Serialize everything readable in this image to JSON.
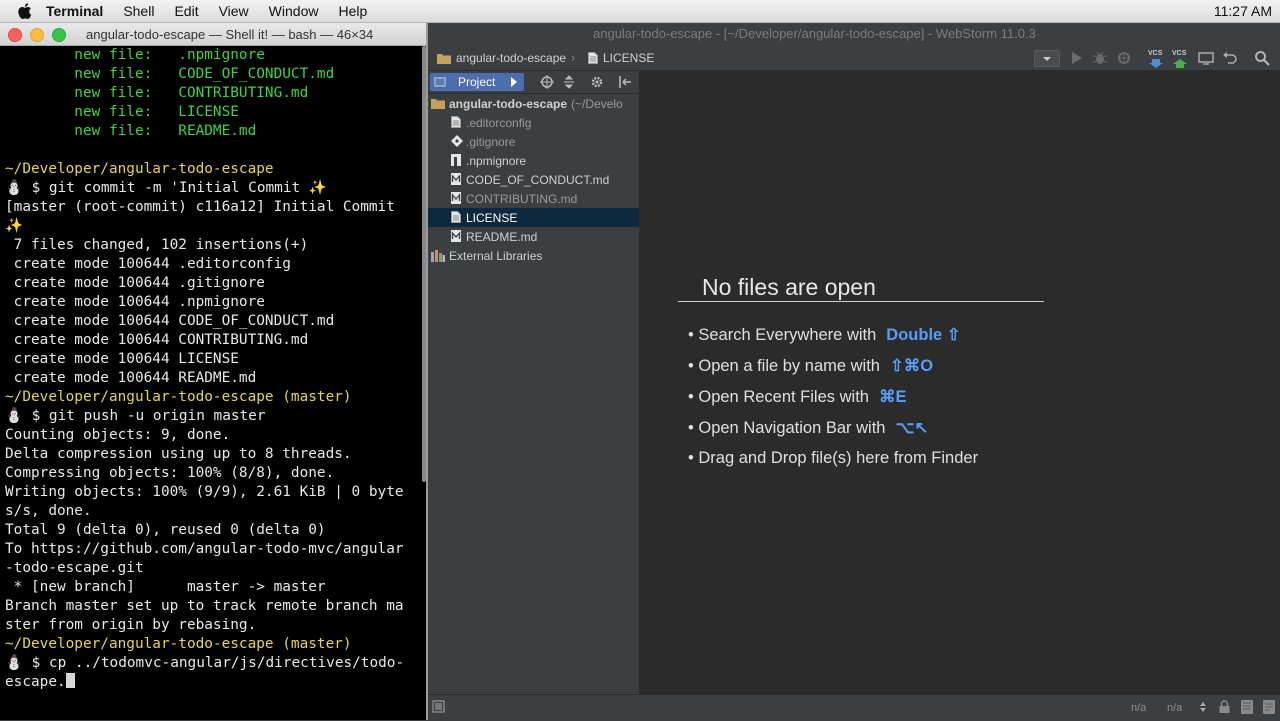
{
  "menubar": {
    "items": [
      "Terminal",
      "Shell",
      "Edit",
      "View",
      "Window",
      "Help"
    ],
    "clock": "11:27 AM"
  },
  "terminal": {
    "title": "angular-todo-escape — Shell it! — bash — 46×34",
    "lines": [
      {
        "parts": [
          {
            "t": "        new file:   .npmignore",
            "c": "g"
          }
        ]
      },
      {
        "parts": [
          {
            "t": "        new file:   CODE_OF_CONDUCT.md",
            "c": "g"
          }
        ]
      },
      {
        "parts": [
          {
            "t": "        new file:   CONTRIBUTING.md",
            "c": "g"
          }
        ]
      },
      {
        "parts": [
          {
            "t": "        new file:   LICENSE",
            "c": "g"
          }
        ]
      },
      {
        "parts": [
          {
            "t": "        new file:   README.md",
            "c": "g"
          }
        ]
      },
      {
        "parts": [
          {
            "t": "",
            "c": ""
          }
        ]
      },
      {
        "parts": [
          {
            "t": "~/Developer/angular-todo-escape",
            "c": "y"
          }
        ]
      },
      {
        "parts": [
          {
            "t": "⛄ $ git commit -m 'Initial Commit ✨",
            "c": ""
          }
        ]
      },
      {
        "parts": [
          {
            "t": "[master (root-commit) c116a12] Initial Commit",
            "c": ""
          }
        ]
      },
      {
        "parts": [
          {
            "t": "✨",
            "c": "y"
          }
        ]
      },
      {
        "parts": [
          {
            "t": " 7 files changed, 102 insertions(+)",
            "c": ""
          }
        ]
      },
      {
        "parts": [
          {
            "t": " create mode 100644 .editorconfig",
            "c": ""
          }
        ]
      },
      {
        "parts": [
          {
            "t": " create mode 100644 .gitignore",
            "c": ""
          }
        ]
      },
      {
        "parts": [
          {
            "t": " create mode 100644 .npmignore",
            "c": ""
          }
        ]
      },
      {
        "parts": [
          {
            "t": " create mode 100644 CODE_OF_CONDUCT.md",
            "c": ""
          }
        ]
      },
      {
        "parts": [
          {
            "t": " create mode 100644 CONTRIBUTING.md",
            "c": ""
          }
        ]
      },
      {
        "parts": [
          {
            "t": " create mode 100644 LICENSE",
            "c": ""
          }
        ]
      },
      {
        "parts": [
          {
            "t": " create mode 100644 README.md",
            "c": ""
          }
        ]
      },
      {
        "parts": [
          {
            "t": "~/Developer/angular-todo-escape (master)",
            "c": "y"
          }
        ]
      },
      {
        "parts": [
          {
            "t": "⛄ $ git push -u origin master",
            "c": ""
          }
        ]
      },
      {
        "parts": [
          {
            "t": "Counting objects: 9, done.",
            "c": ""
          }
        ]
      },
      {
        "parts": [
          {
            "t": "Delta compression using up to 8 threads.",
            "c": ""
          }
        ]
      },
      {
        "parts": [
          {
            "t": "Compressing objects: 100% (8/8), done.",
            "c": ""
          }
        ]
      },
      {
        "parts": [
          {
            "t": "Writing objects: 100% (9/9), 2.61 KiB | 0 byte",
            "c": ""
          }
        ]
      },
      {
        "parts": [
          {
            "t": "s/s, done.",
            "c": ""
          }
        ]
      },
      {
        "parts": [
          {
            "t": "Total 9 (delta 0), reused 0 (delta 0)",
            "c": ""
          }
        ]
      },
      {
        "parts": [
          {
            "t": "To https://github.com/angular-todo-mvc/angular",
            "c": ""
          }
        ]
      },
      {
        "parts": [
          {
            "t": "-todo-escape.git",
            "c": ""
          }
        ]
      },
      {
        "parts": [
          {
            "t": " * [new branch]      master -> master",
            "c": ""
          }
        ]
      },
      {
        "parts": [
          {
            "t": "Branch master set up to track remote branch ma",
            "c": ""
          }
        ]
      },
      {
        "parts": [
          {
            "t": "ster from origin by rebasing.",
            "c": ""
          }
        ]
      },
      {
        "parts": [
          {
            "t": "~/Developer/angular-todo-escape (master)",
            "c": "y"
          }
        ]
      },
      {
        "parts": [
          {
            "t": "⛄ $ cp ../todomvc-angular/js/directives/todo-",
            "c": ""
          }
        ]
      },
      {
        "parts": [
          {
            "t": "escape.",
            "c": ""
          }
        ],
        "cursor": true
      }
    ]
  },
  "ide": {
    "window_title": "angular-todo-escape - [~/Developer/angular-todo-escape] - WebStorm 11.0.3",
    "breadcrumbs": [
      "angular-todo-escape",
      "LICENSE"
    ],
    "project_tab": "Project",
    "vcs_label": "VCS",
    "tree": {
      "root_name": "angular-todo-escape",
      "root_path": "(~/Develo",
      "files": [
        {
          "name": ".editorconfig",
          "dim": true,
          "icon": "file-icon"
        },
        {
          "name": ".gitignore",
          "dim": true,
          "icon": "git-ignore-icon"
        },
        {
          "name": ".npmignore",
          "dim": false,
          "icon": "npm-icon"
        },
        {
          "name": "CODE_OF_CONDUCT.md",
          "dim": false,
          "icon": "markdown-icon"
        },
        {
          "name": "CONTRIBUTING.md",
          "dim": true,
          "icon": "markdown-icon"
        },
        {
          "name": "LICENSE",
          "dim": false,
          "icon": "file-icon",
          "selected": true
        },
        {
          "name": "README.md",
          "dim": false,
          "icon": "markdown-icon"
        }
      ],
      "external": "External Libraries"
    },
    "editor": {
      "heading": "No files are open",
      "tips": [
        {
          "text": "Search Everywhere with",
          "shortcut": "Double ⇧"
        },
        {
          "text": "Open a file by name with",
          "shortcut": "⇧⌘O"
        },
        {
          "text": "Open Recent Files with",
          "shortcut": "⌘E"
        },
        {
          "text": "Open Navigation Bar with",
          "shortcut": "⌥↖"
        },
        {
          "text": "Drag and Drop file(s) here from Finder",
          "shortcut": ""
        }
      ]
    },
    "status": {
      "pos1": "n/a",
      "pos2": "n/a"
    }
  },
  "colors": {
    "prompt": "#e8d44a",
    "git_new_file": "#3ed43e",
    "shortcut": "#589df6",
    "selection": "#0d293e",
    "project_tab": "#4b6eaf"
  }
}
